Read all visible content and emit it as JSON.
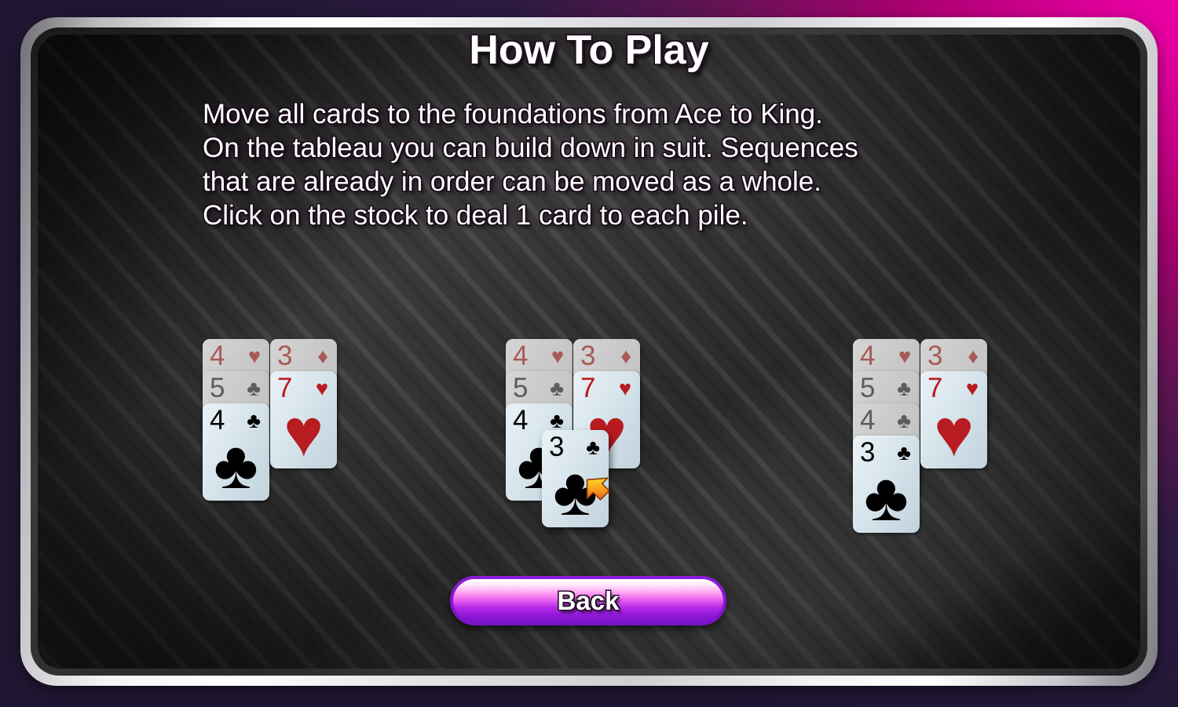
{
  "screen": {
    "title": "How To Play",
    "theme": {
      "accent_magenta": "#e0009c",
      "felt_purple": "#aa21cd",
      "frame_silver": "#f2f2f5",
      "card_face": "#dce8ee",
      "card_red": "#b81b20",
      "card_black": "#000000",
      "button_purple": "#8c1bd8"
    }
  },
  "instructions": {
    "lines": [
      "Move all cards to the foundations from Ace to King.",
      "On the tableau you can build down in suit. Sequences",
      "that are already in order can be moved as a whole.",
      "Click on the stock to deal 1 card to each pile."
    ]
  },
  "illustration": {
    "caption_order": [
      "before",
      "during",
      "after"
    ],
    "groups": [
      {
        "name": "before",
        "piles": [
          {
            "name": "left-pile",
            "cards": [
              {
                "rank": "4",
                "suit": "hearts",
                "pip": "♥",
                "color": "red",
                "state": "covered"
              },
              {
                "rank": "5",
                "suit": "clubs",
                "pip": "♣",
                "color": "black",
                "state": "covered"
              },
              {
                "rank": "4",
                "suit": "clubs",
                "pip": "♣",
                "color": "black",
                "state": "top"
              }
            ]
          },
          {
            "name": "right-pile",
            "cards": [
              {
                "rank": "3",
                "suit": "diamonds",
                "pip": "♦",
                "color": "red",
                "state": "covered"
              },
              {
                "rank": "7",
                "suit": "hearts",
                "pip": "♥",
                "color": "red",
                "state": "top"
              }
            ]
          }
        ],
        "dragged_card": null,
        "cursor": false
      },
      {
        "name": "during",
        "piles": [
          {
            "name": "left-pile",
            "cards": [
              {
                "rank": "4",
                "suit": "hearts",
                "pip": "♥",
                "color": "red",
                "state": "covered"
              },
              {
                "rank": "5",
                "suit": "clubs",
                "pip": "♣",
                "color": "black",
                "state": "covered"
              },
              {
                "rank": "4",
                "suit": "clubs",
                "pip": "♣",
                "color": "black",
                "state": "top"
              }
            ]
          },
          {
            "name": "right-pile",
            "cards": [
              {
                "rank": "3",
                "suit": "diamonds",
                "pip": "♦",
                "color": "red",
                "state": "covered"
              },
              {
                "rank": "7",
                "suit": "hearts",
                "pip": "♥",
                "color": "red",
                "state": "top"
              }
            ]
          }
        ],
        "dragged_card": {
          "rank": "3",
          "suit": "clubs",
          "pip": "♣",
          "color": "black"
        },
        "cursor": true
      },
      {
        "name": "after",
        "piles": [
          {
            "name": "left-pile",
            "cards": [
              {
                "rank": "4",
                "suit": "hearts",
                "pip": "♥",
                "color": "red",
                "state": "covered"
              },
              {
                "rank": "5",
                "suit": "clubs",
                "pip": "♣",
                "color": "black",
                "state": "covered"
              },
              {
                "rank": "4",
                "suit": "clubs",
                "pip": "♣",
                "color": "black",
                "state": "covered"
              },
              {
                "rank": "3",
                "suit": "clubs",
                "pip": "♣",
                "color": "black",
                "state": "top"
              }
            ]
          },
          {
            "name": "right-pile",
            "cards": [
              {
                "rank": "3",
                "suit": "diamonds",
                "pip": "♦",
                "color": "red",
                "state": "covered"
              },
              {
                "rank": "7",
                "suit": "hearts",
                "pip": "♥",
                "color": "red",
                "state": "top"
              }
            ]
          }
        ],
        "dragged_card": null,
        "cursor": false
      }
    ]
  },
  "footer": {
    "back_label": "Back"
  }
}
